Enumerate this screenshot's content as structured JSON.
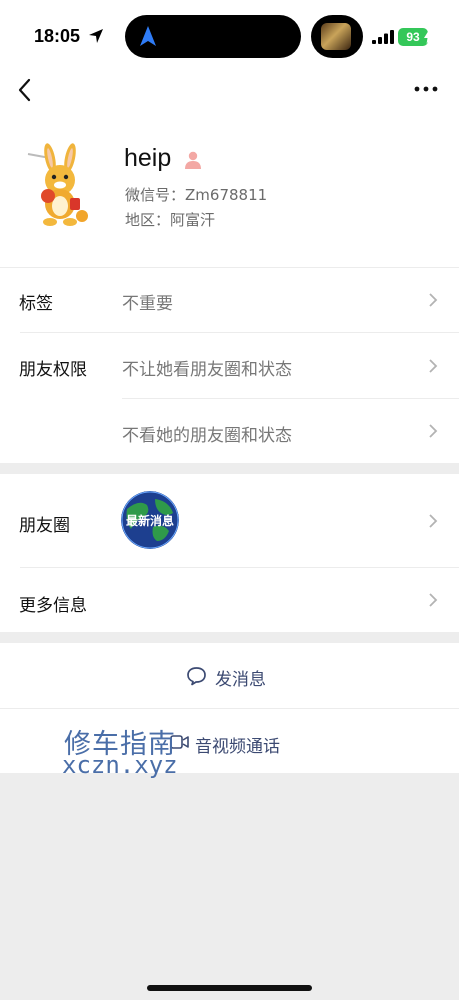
{
  "status_bar": {
    "time": "18:05",
    "battery": "93"
  },
  "nav": {
    "back_icon": "chevron-left-icon",
    "more_icon": "ellipsis-icon"
  },
  "profile": {
    "nickname": "heip",
    "wechat_id_label": "微信号：",
    "wechat_id": "Zm678811",
    "region_label": "地区：",
    "region": "阿富汗"
  },
  "rows": {
    "tags": {
      "label": "标签",
      "value": "不重要"
    },
    "permissions": {
      "label": "朋友权限",
      "value_1": "不让她看朋友圈和状态",
      "value_2": "不看她的朋友圈和状态"
    },
    "moments": {
      "label": "朋友圈",
      "thumb_text": "最新消息"
    },
    "more_info": {
      "label": "更多信息"
    }
  },
  "actions": {
    "message": "发消息",
    "call": "音视频通话"
  },
  "watermark": {
    "cn": "修车指南",
    "url": "xczn.xyz"
  },
  "colors": {
    "battery": "#34c759",
    "link_blue": "#3c4a72",
    "background": "#ededed"
  }
}
